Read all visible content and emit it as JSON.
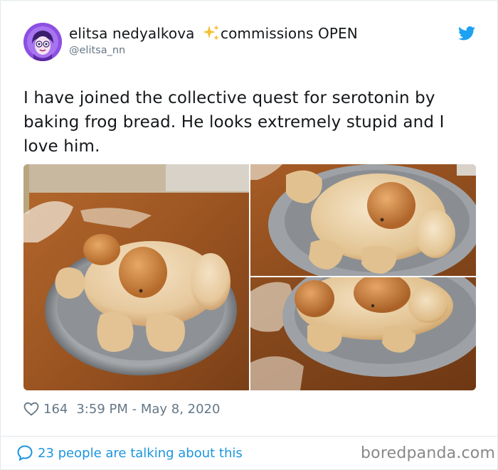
{
  "author": {
    "display_name": "elitsa nedyalkova",
    "status_emoji": "sparkles-emoji",
    "status_text": "commissions OPEN",
    "handle": "@elitsa_nn",
    "avatar_icon": "avatar-illustration"
  },
  "tweet": {
    "text": "I have joined the collective quest for serotonin by baking frog bread. He looks extremely stupid and I love him.",
    "photos": [
      {
        "description_icon": "frog-bread-photo-front"
      },
      {
        "description_icon": "frog-bread-photo-top"
      },
      {
        "description_icon": "frog-bread-photo-side"
      }
    ]
  },
  "meta": {
    "likes": "164",
    "timestamp": "3:59 PM - May 8, 2020"
  },
  "footer": {
    "talking": "23 people are talking about this",
    "watermark": "boredpanda.com"
  },
  "colors": {
    "text": "#14171a",
    "secondary": "#657786",
    "link": "#1b95e0",
    "twitter_blue": "#1da1f2",
    "border": "#e1e8ed"
  }
}
